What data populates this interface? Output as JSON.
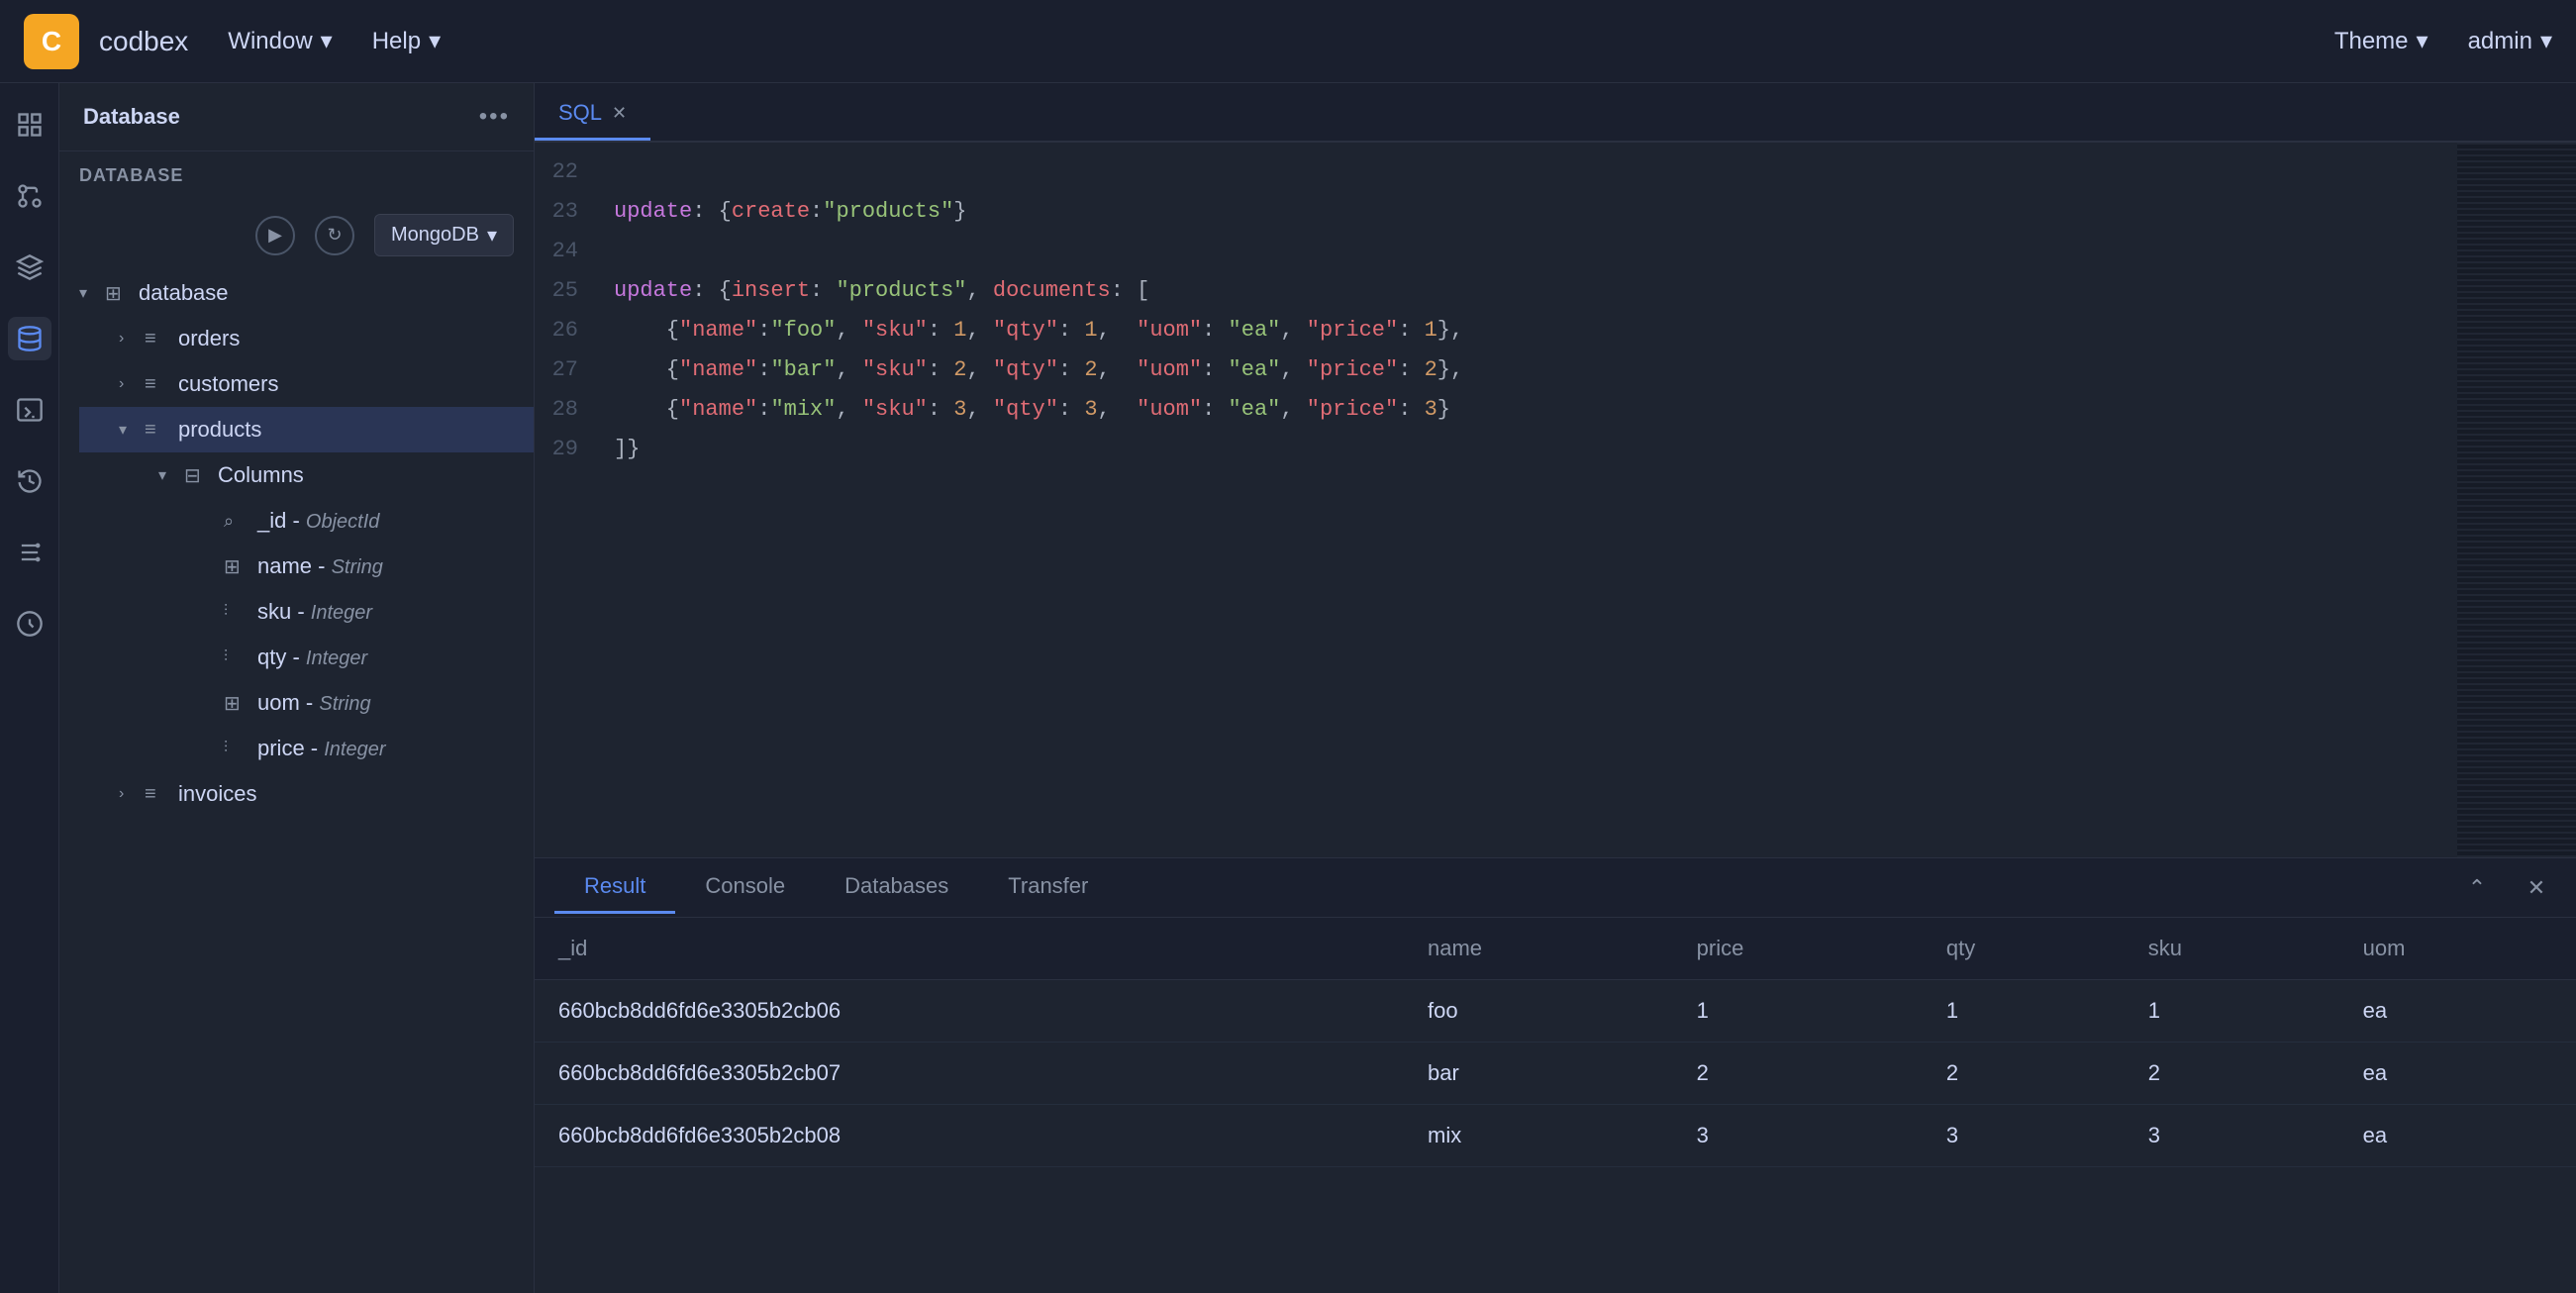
{
  "app": {
    "logo": "C",
    "name": "codbex",
    "menu": [
      {
        "label": "Window",
        "has_arrow": true
      },
      {
        "label": "Help",
        "has_arrow": true
      }
    ],
    "right_menu": [
      {
        "label": "Theme",
        "has_arrow": true
      },
      {
        "label": "admin",
        "has_arrow": true
      }
    ]
  },
  "sidebar": {
    "title": "Database",
    "section_label": "DATABASE",
    "db_select": "MongoDB",
    "tree": [
      {
        "label": "database",
        "expanded": true,
        "icon": "grid",
        "children": [
          {
            "label": "orders",
            "icon": "list",
            "expanded": false
          },
          {
            "label": "customers",
            "icon": "list",
            "expanded": false
          },
          {
            "label": "products",
            "icon": "list",
            "expanded": true,
            "active": true,
            "children": [
              {
                "label": "Columns",
                "icon": "table",
                "expanded": true,
                "children": [
                  {
                    "label": "_id",
                    "type": "ObjectId",
                    "icon": "search"
                  },
                  {
                    "label": "name",
                    "type": "String",
                    "icon": "grid"
                  },
                  {
                    "label": "sku",
                    "type": "Integer",
                    "icon": "lines"
                  },
                  {
                    "label": "qty",
                    "type": "Integer",
                    "icon": "lines"
                  },
                  {
                    "label": "uom",
                    "type": "String",
                    "icon": "grid"
                  },
                  {
                    "label": "price",
                    "type": "Integer",
                    "icon": "lines"
                  }
                ]
              }
            ]
          },
          {
            "label": "invoices",
            "icon": "list",
            "expanded": false
          }
        ]
      }
    ]
  },
  "editor": {
    "tab_label": "SQL",
    "lines": [
      {
        "num": 22,
        "tokens": []
      },
      {
        "num": 23,
        "code": "update: {create:\"products\"}"
      },
      {
        "num": 24,
        "tokens": []
      },
      {
        "num": 25,
        "code": "update: {insert: \"products\", documents: ["
      },
      {
        "num": 26,
        "code": "    {\"name\":\"foo\", \"sku\": 1, \"qty\": 1,  \"uom\": \"ea\", \"price\": 1},"
      },
      {
        "num": 27,
        "code": "    {\"name\":\"bar\", \"sku\": 2, \"qty\": 2,  \"uom\": \"ea\", \"price\": 2},"
      },
      {
        "num": 28,
        "code": "    {\"name\":\"mix\", \"sku\": 3, \"qty\": 3,  \"uom\": \"ea\", \"price\": 3}"
      },
      {
        "num": 29,
        "code": "]}"
      }
    ]
  },
  "result": {
    "tabs": [
      "Result",
      "Console",
      "Databases",
      "Transfer"
    ],
    "active_tab": "Result",
    "columns": [
      "_id",
      "name",
      "price",
      "qty",
      "sku",
      "uom"
    ],
    "rows": [
      {
        "_id": "660bcb8dd6fd6e3305b2cb06",
        "name": "foo",
        "price": "1",
        "qty": "1",
        "sku": "1",
        "uom": "ea"
      },
      {
        "_id": "660bcb8dd6fd6e3305b2cb07",
        "name": "bar",
        "price": "2",
        "qty": "2",
        "sku": "2",
        "uom": "ea"
      },
      {
        "_id": "660bcb8dd6fd6e3305b2cb08",
        "name": "mix",
        "price": "3",
        "qty": "3",
        "sku": "3",
        "uom": "ea"
      }
    ]
  },
  "icons": {
    "chevron_down": "▾",
    "chevron_right": "›",
    "chevron_up": "▴",
    "close": "✕",
    "dots": "•••",
    "play": "▶",
    "refresh": "↻",
    "collapse": "⌃",
    "grid": "⊞",
    "list": "≡",
    "search": "⌕",
    "lines": "⫶"
  }
}
